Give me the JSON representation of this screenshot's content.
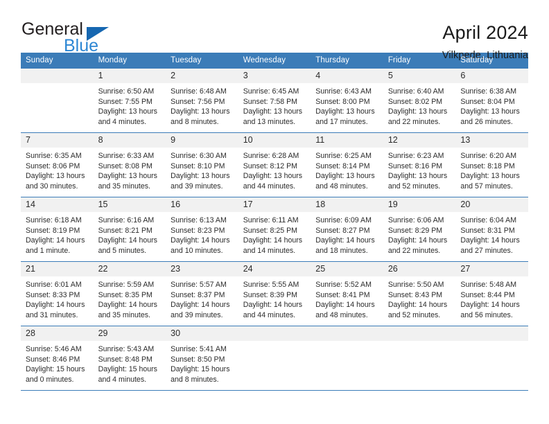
{
  "brand": {
    "word_one": "General",
    "word_two": "Blue",
    "triangle_icon": "blue-triangle-icon",
    "colors": {
      "general": "#231f20",
      "blue": "#2d87d4",
      "triangle": "#1667b1"
    }
  },
  "header": {
    "title": "April 2024",
    "subtitle": "Vilkpede, Lithuania"
  },
  "theme": {
    "header_bar": "#3b7cb8",
    "daynum_bg": "#f1f1f1",
    "rule": "#3b7cb8",
    "text": "#2b2b2b"
  },
  "weekdays": [
    "Sunday",
    "Monday",
    "Tuesday",
    "Wednesday",
    "Thursday",
    "Friday",
    "Saturday"
  ],
  "weeks": [
    [
      {
        "day": "",
        "details": ""
      },
      {
        "day": "1",
        "details": "Sunrise: 6:50 AM\nSunset: 7:55 PM\nDaylight: 13 hours\nand 4 minutes."
      },
      {
        "day": "2",
        "details": "Sunrise: 6:48 AM\nSunset: 7:56 PM\nDaylight: 13 hours\nand 8 minutes."
      },
      {
        "day": "3",
        "details": "Sunrise: 6:45 AM\nSunset: 7:58 PM\nDaylight: 13 hours\nand 13 minutes."
      },
      {
        "day": "4",
        "details": "Sunrise: 6:43 AM\nSunset: 8:00 PM\nDaylight: 13 hours\nand 17 minutes."
      },
      {
        "day": "5",
        "details": "Sunrise: 6:40 AM\nSunset: 8:02 PM\nDaylight: 13 hours\nand 22 minutes."
      },
      {
        "day": "6",
        "details": "Sunrise: 6:38 AM\nSunset: 8:04 PM\nDaylight: 13 hours\nand 26 minutes."
      }
    ],
    [
      {
        "day": "7",
        "details": "Sunrise: 6:35 AM\nSunset: 8:06 PM\nDaylight: 13 hours\nand 30 minutes."
      },
      {
        "day": "8",
        "details": "Sunrise: 6:33 AM\nSunset: 8:08 PM\nDaylight: 13 hours\nand 35 minutes."
      },
      {
        "day": "9",
        "details": "Sunrise: 6:30 AM\nSunset: 8:10 PM\nDaylight: 13 hours\nand 39 minutes."
      },
      {
        "day": "10",
        "details": "Sunrise: 6:28 AM\nSunset: 8:12 PM\nDaylight: 13 hours\nand 44 minutes."
      },
      {
        "day": "11",
        "details": "Sunrise: 6:25 AM\nSunset: 8:14 PM\nDaylight: 13 hours\nand 48 minutes."
      },
      {
        "day": "12",
        "details": "Sunrise: 6:23 AM\nSunset: 8:16 PM\nDaylight: 13 hours\nand 52 minutes."
      },
      {
        "day": "13",
        "details": "Sunrise: 6:20 AM\nSunset: 8:18 PM\nDaylight: 13 hours\nand 57 minutes."
      }
    ],
    [
      {
        "day": "14",
        "details": "Sunrise: 6:18 AM\nSunset: 8:19 PM\nDaylight: 14 hours\nand 1 minute."
      },
      {
        "day": "15",
        "details": "Sunrise: 6:16 AM\nSunset: 8:21 PM\nDaylight: 14 hours\nand 5 minutes."
      },
      {
        "day": "16",
        "details": "Sunrise: 6:13 AM\nSunset: 8:23 PM\nDaylight: 14 hours\nand 10 minutes."
      },
      {
        "day": "17",
        "details": "Sunrise: 6:11 AM\nSunset: 8:25 PM\nDaylight: 14 hours\nand 14 minutes."
      },
      {
        "day": "18",
        "details": "Sunrise: 6:09 AM\nSunset: 8:27 PM\nDaylight: 14 hours\nand 18 minutes."
      },
      {
        "day": "19",
        "details": "Sunrise: 6:06 AM\nSunset: 8:29 PM\nDaylight: 14 hours\nand 22 minutes."
      },
      {
        "day": "20",
        "details": "Sunrise: 6:04 AM\nSunset: 8:31 PM\nDaylight: 14 hours\nand 27 minutes."
      }
    ],
    [
      {
        "day": "21",
        "details": "Sunrise: 6:01 AM\nSunset: 8:33 PM\nDaylight: 14 hours\nand 31 minutes."
      },
      {
        "day": "22",
        "details": "Sunrise: 5:59 AM\nSunset: 8:35 PM\nDaylight: 14 hours\nand 35 minutes."
      },
      {
        "day": "23",
        "details": "Sunrise: 5:57 AM\nSunset: 8:37 PM\nDaylight: 14 hours\nand 39 minutes."
      },
      {
        "day": "24",
        "details": "Sunrise: 5:55 AM\nSunset: 8:39 PM\nDaylight: 14 hours\nand 44 minutes."
      },
      {
        "day": "25",
        "details": "Sunrise: 5:52 AM\nSunset: 8:41 PM\nDaylight: 14 hours\nand 48 minutes."
      },
      {
        "day": "26",
        "details": "Sunrise: 5:50 AM\nSunset: 8:43 PM\nDaylight: 14 hours\nand 52 minutes."
      },
      {
        "day": "27",
        "details": "Sunrise: 5:48 AM\nSunset: 8:44 PM\nDaylight: 14 hours\nand 56 minutes."
      }
    ],
    [
      {
        "day": "28",
        "details": "Sunrise: 5:46 AM\nSunset: 8:46 PM\nDaylight: 15 hours\nand 0 minutes."
      },
      {
        "day": "29",
        "details": "Sunrise: 5:43 AM\nSunset: 8:48 PM\nDaylight: 15 hours\nand 4 minutes."
      },
      {
        "day": "30",
        "details": "Sunrise: 5:41 AM\nSunset: 8:50 PM\nDaylight: 15 hours\nand 8 minutes."
      },
      {
        "day": "",
        "details": ""
      },
      {
        "day": "",
        "details": ""
      },
      {
        "day": "",
        "details": ""
      },
      {
        "day": "",
        "details": ""
      }
    ]
  ]
}
